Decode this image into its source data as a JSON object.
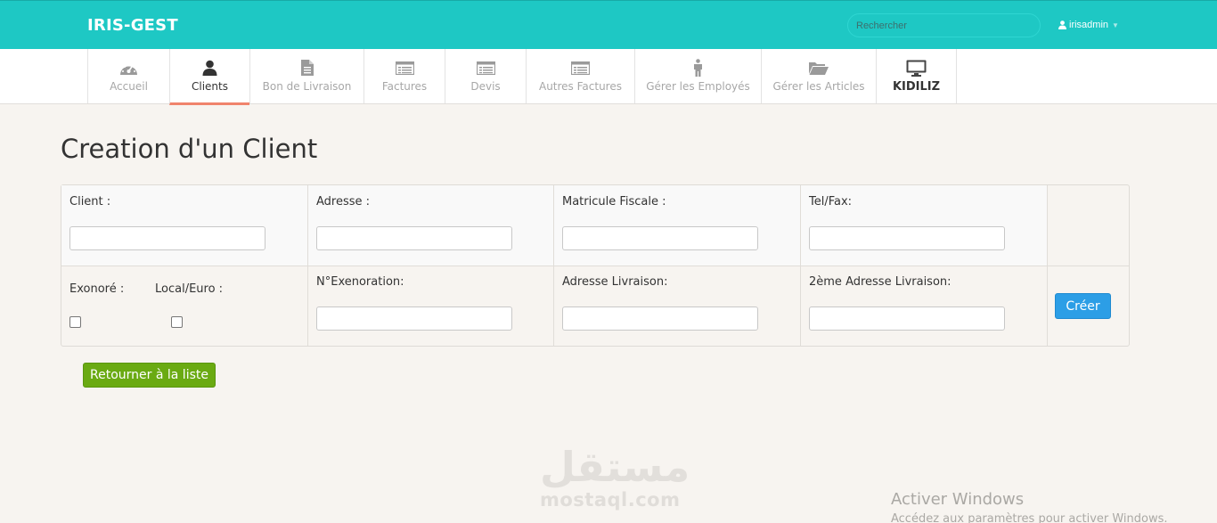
{
  "header": {
    "brand": "IRIS-GEST",
    "search_placeholder": "Rechercher",
    "username": "irisadmin"
  },
  "nav": {
    "items": [
      {
        "label": "Accueil",
        "icon": "dashboard-icon"
      },
      {
        "label": "Clients",
        "icon": "user-icon",
        "active": true
      },
      {
        "label": "Bon de Livraison",
        "icon": "file-icon"
      },
      {
        "label": "Factures",
        "icon": "list-icon"
      },
      {
        "label": "Devis",
        "icon": "list-icon"
      },
      {
        "label": "Autres Factures",
        "icon": "list-icon"
      },
      {
        "label": "Gérer les Employés",
        "icon": "person-icon"
      },
      {
        "label": "Gérer les Articles",
        "icon": "folder-open-icon"
      },
      {
        "label": "KIDILIZ",
        "icon": "monitor-icon"
      }
    ]
  },
  "page": {
    "title": "Creation d'un Client"
  },
  "form": {
    "client_label": "Client :",
    "adresse_label": "Adresse :",
    "matricule_label": "Matricule Fiscale :",
    "telfax_label": "Tel/Fax:",
    "exonore_label": "Exonoré :",
    "localeuro_label": "Local/Euro :",
    "nexoneration_label": "N°Exenoration:",
    "adresse_livraison_label": "Adresse Livraison:",
    "adresse2_livraison_label": "2ème Adresse Livraison:",
    "create_button": "Créer",
    "back_button": "Retourner à la liste",
    "client_value": "",
    "adresse_value": "",
    "matricule_value": "",
    "telfax_value": "",
    "nexoneration_value": "",
    "adresse_livraison_value": "",
    "adresse2_livraison_value": "",
    "exonore_checked": false,
    "localeuro_checked": false
  },
  "watermark": {
    "arabic": "مستقل",
    "latin": "mostaql.com"
  },
  "windows_activation": {
    "title": "Activer Windows",
    "subtitle": "Accédez aux paramètres pour activer Windows."
  },
  "colors": {
    "topbar": "#1ec8c4",
    "active_tab_underline": "#f0836c",
    "create_button": "#2c9ee6",
    "back_button": "#6aaa12",
    "page_background": "#f7f4f0"
  }
}
